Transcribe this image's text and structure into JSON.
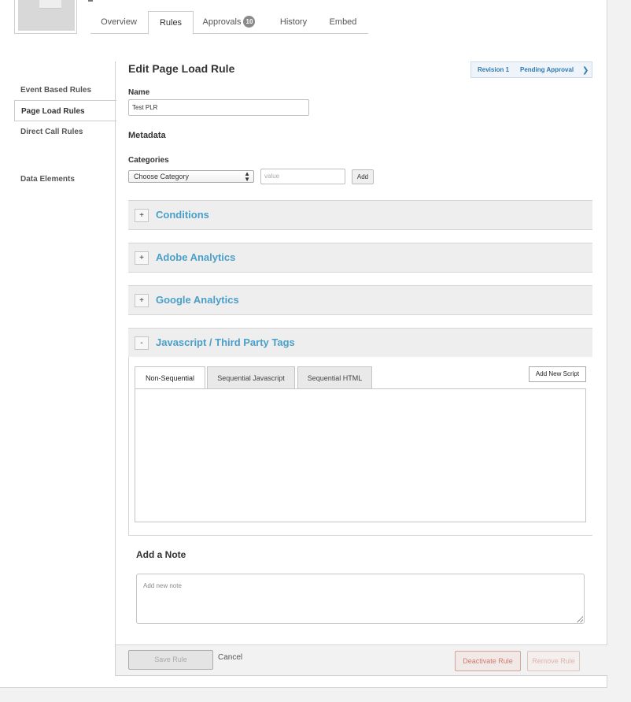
{
  "tabs": [
    {
      "label": "Overview"
    },
    {
      "label": "Rules"
    },
    {
      "label": "Approvals",
      "badge": "10"
    },
    {
      "label": "History"
    },
    {
      "label": "Embed"
    }
  ],
  "sidebar": {
    "items": [
      {
        "label": "Event Based Rules"
      },
      {
        "label": "Page Load Rules"
      },
      {
        "label": "Direct Call Rules"
      },
      {
        "label": "Data Elements"
      }
    ]
  },
  "editor": {
    "title": "Edit Page Load Rule",
    "revision": "Revision 1",
    "status": "Pending Approval",
    "name_label": "Name",
    "name_value": "Test PLR",
    "metadata_heading": "Metadata",
    "categories_label": "Categories",
    "category_select": "Choose Category",
    "value_placeholder": "value",
    "add_label": "Add"
  },
  "sections": [
    {
      "toggle": "+",
      "title": "Conditions"
    },
    {
      "toggle": "+",
      "title": "Adobe Analytics"
    },
    {
      "toggle": "+",
      "title": "Google Analytics"
    },
    {
      "toggle": "-",
      "title": "Javascript / Third Party Tags"
    }
  ],
  "script_tabs": [
    {
      "label": "Non-Sequential"
    },
    {
      "label": "Sequential Javascript"
    },
    {
      "label": "Sequential HTML"
    }
  ],
  "add_script_label": "Add New Script",
  "note": {
    "title": "Add a Note",
    "placeholder": "Add new note"
  },
  "footer": {
    "save": "Save Rule",
    "cancel": "Cancel",
    "deactivate": "Deactivate Rule",
    "remove": "Remove Rule"
  },
  "colors": {
    "accent": "#4a9fc9",
    "revision_text": "#2f78b0",
    "danger": "#d07b6c"
  }
}
